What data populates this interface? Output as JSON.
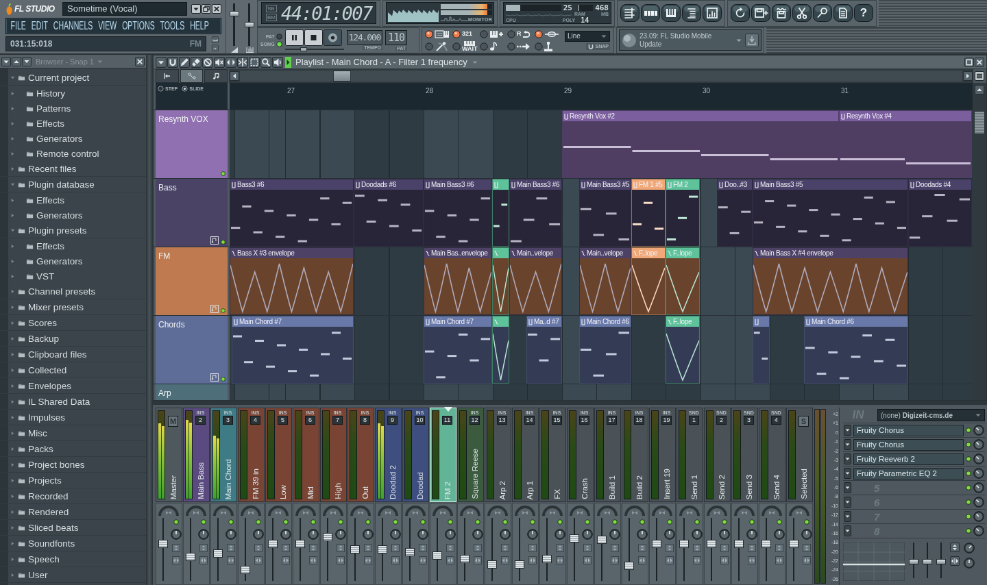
{
  "title_bar": {
    "logo": "FL STUDIO",
    "song_title": "Sometime (Vocal)"
  },
  "menu": [
    "FILE",
    "EDIT",
    "CHANNELS",
    "VIEW",
    "OPTIONS",
    "TOOLS",
    "HELP"
  ],
  "hint_bar": {
    "position": "031:15:018",
    "channel": "FM"
  },
  "master_sliders": [
    {
      "kind": "volume",
      "level": 0.8
    },
    {
      "kind": "pitch",
      "level": 0.5
    }
  ],
  "time_display": {
    "modes": [
      "SB",
      "BM"
    ],
    "time": "44:01:007"
  },
  "monitor": {
    "label": "MONITOR",
    "meters": [
      {
        "level": 0.9
      },
      {
        "level": 0.9
      }
    ]
  },
  "performance": {
    "cpu": {
      "label": "CPU",
      "value": "25",
      "level": 0.26
    },
    "ram": {
      "label": "RAM",
      "value": "468",
      "unit": "MB",
      "level": 0.06
    },
    "poly": {
      "label": "POLY",
      "value": "14"
    }
  },
  "view_buttons": [
    {
      "kind": "playlist"
    },
    {
      "kind": "step_sequencer"
    },
    {
      "kind": "piano_roll"
    },
    {
      "kind": "browser"
    },
    {
      "kind": "mixer"
    }
  ],
  "tool_buttons": [
    {
      "kind": "undo"
    },
    {
      "kind": "save"
    },
    {
      "kind": "export"
    },
    {
      "kind": "cut"
    },
    {
      "kind": "microphone"
    },
    {
      "kind": "document"
    },
    {
      "kind": "help",
      "label": "?"
    }
  ],
  "transport": {
    "modes": [
      {
        "label": "PAT",
        "selected": false
      },
      {
        "label": "SONG",
        "selected": true
      }
    ],
    "buttons": [
      {
        "kind": "pause"
      },
      {
        "kind": "stop"
      },
      {
        "kind": "record"
      }
    ],
    "slider": {
      "level": 0.3
    },
    "tempo": {
      "value": "124.000",
      "label": "TEMPO"
    },
    "pattern": {
      "value": "110",
      "label": "PAT"
    }
  },
  "toggles": [
    {
      "kind": "typing_keyboard",
      "on": true
    },
    {
      "kind": "countdown",
      "label": "321",
      "on": true
    },
    {
      "kind": "step_edit",
      "on": false
    },
    {
      "kind": "loop_record",
      "label": "R",
      "on": false
    },
    {
      "kind": "blend",
      "on": true
    },
    {
      "kind": "metronome",
      "on": false
    },
    {
      "kind": "wait",
      "label": "WAIT",
      "on": false
    },
    {
      "kind": "note_record",
      "on": false
    },
    {
      "kind": "arrow",
      "on": false
    },
    {
      "kind": "joystick",
      "on": false
    }
  ],
  "snap": {
    "value": "Line",
    "label": "SNAP"
  },
  "news": {
    "text": "23.09: FL Studio Mobile Update"
  },
  "browser": {
    "title": "Browser - Snap 1",
    "items": [
      {
        "label": "Current project",
        "expanded": true,
        "children": [
          {
            "label": "History",
            "expanded": false
          },
          {
            "label": "Patterns",
            "expanded": false
          },
          {
            "label": "Effects",
            "expanded": false
          },
          {
            "label": "Generators",
            "expanded": false
          },
          {
            "label": "Remote control",
            "expanded": false
          }
        ]
      },
      {
        "label": "Recent files",
        "expanded": false
      },
      {
        "label": "Plugin database",
        "expanded": true,
        "children": [
          {
            "label": "Effects",
            "expanded": false
          },
          {
            "label": "Generators",
            "expanded": false
          }
        ]
      },
      {
        "label": "Plugin presets",
        "expanded": true,
        "children": [
          {
            "label": "Effects",
            "expanded": false
          },
          {
            "label": "Generators",
            "expanded": false
          },
          {
            "label": "VST",
            "expanded": false
          }
        ]
      },
      {
        "label": "Channel presets",
        "expanded": false
      },
      {
        "label": "Mixer presets",
        "expanded": false
      },
      {
        "label": "Scores",
        "expanded": false
      },
      {
        "label": "Backup",
        "expanded": false
      },
      {
        "label": "Clipboard files",
        "expanded": false
      },
      {
        "label": "Collected",
        "expanded": false
      },
      {
        "label": "Envelopes",
        "expanded": false
      },
      {
        "label": "IL Shared Data",
        "expanded": false
      },
      {
        "label": "Impulses",
        "expanded": false
      },
      {
        "label": "Misc",
        "expanded": false
      },
      {
        "label": "Packs",
        "expanded": false
      },
      {
        "label": "Project bones",
        "expanded": false
      },
      {
        "label": "Projects",
        "expanded": false
      },
      {
        "label": "Recorded",
        "expanded": false
      },
      {
        "label": "Rendered",
        "expanded": false
      },
      {
        "label": "Sliced beats",
        "expanded": false
      },
      {
        "label": "Soundfonts",
        "expanded": false
      },
      {
        "label": "Speech",
        "expanded": false
      },
      {
        "label": "User",
        "expanded": false
      }
    ]
  },
  "playlist": {
    "title": "Playlist - Main Chord - A - Filter 1 frequency",
    "tabs": [
      {
        "kind": "start",
        "selected": false
      },
      {
        "kind": "automation",
        "selected": true
      },
      {
        "kind": "note",
        "selected": false
      }
    ],
    "modes": [
      {
        "label": "STEP",
        "selected": false
      },
      {
        "label": "SLIDE",
        "selected": true
      }
    ],
    "ruler": [
      "27",
      "28",
      "29",
      "30",
      "31"
    ],
    "tracks": [
      {
        "name": "Resynth VOX",
        "color": "#9070b0",
        "clips": [
          {
            "name": "Resynth Vox #2",
            "kind": "pattern",
            "color": "#7b5e9e"
          },
          {
            "name": "Resynth Vox #4",
            "kind": "pattern",
            "color": "#7b5e9e"
          }
        ]
      },
      {
        "name": "Bass",
        "color": "#4a4366",
        "clips": [
          {
            "name": "Bass3 #6",
            "kind": "pattern",
            "color": "#4a4268"
          },
          {
            "name": "Doodads #6",
            "kind": "pattern",
            "color": "#4a4268"
          },
          {
            "name": "Main Bass3 #6",
            "kind": "pattern",
            "color": "#4a4268"
          },
          {
            "kind": "pattern",
            "color": "#5ec39b"
          },
          {
            "name": "Main Bass3 #6",
            "kind": "pattern",
            "color": "#4a4268"
          },
          {
            "name": "Main Bass3 #5",
            "kind": "pattern",
            "color": "#4a4268"
          },
          {
            "name": "FM 1 #5",
            "kind": "pattern",
            "color": "#f0a878"
          },
          {
            "name": "FM 2",
            "kind": "pattern",
            "color": "#5ec39b"
          },
          {
            "name": "Doo..#3",
            "kind": "pattern",
            "color": "#4a4268"
          },
          {
            "name": "Main Bass3 #5",
            "kind": "pattern",
            "color": "#4a4268"
          },
          {
            "name": "Doodads #4",
            "kind": "pattern",
            "color": "#4a4268"
          }
        ]
      },
      {
        "name": "FM",
        "color": "#c07a50",
        "clips": [
          {
            "name": "Bass X #3 envelope",
            "kind": "automation",
            "color": "#4d4266"
          },
          {
            "name": "Main Bas..envelope",
            "kind": "automation",
            "color": "#4d4266"
          },
          {
            "kind": "automation",
            "color": "#5ec39b"
          },
          {
            "name": "Main..velope",
            "kind": "automation",
            "color": "#4d4266"
          },
          {
            "name": "Main..velope",
            "kind": "automation",
            "color": "#4d4266"
          },
          {
            "name": "F..lope",
            "kind": "automation",
            "color": "#f0a878"
          },
          {
            "name": "F..lope",
            "kind": "automation",
            "color": "#5ec39b"
          },
          {
            "name": "Main Bass X #4 envelope",
            "kind": "automation",
            "color": "#4d4266"
          }
        ]
      },
      {
        "name": "Chords",
        "color": "#5e6c98",
        "clips": [
          {
            "name": "Main Chord #7",
            "kind": "pattern",
            "color": "#6878a8"
          },
          {
            "name": "Main Chord #7",
            "kind": "pattern",
            "color": "#6878a8"
          },
          {
            "kind": "automation",
            "color": "#5ec39b"
          },
          {
            "name": "Ma..d #7",
            "kind": "pattern",
            "color": "#6878a8"
          },
          {
            "name": "Main Chord #6",
            "kind": "pattern",
            "color": "#6878a8"
          },
          {
            "name": "F..lope",
            "kind": "automation",
            "color": "#5ec39b"
          },
          {
            "kind": "pattern",
            "color": "#6878a8"
          },
          {
            "name": "Main Chord #6",
            "kind": "pattern",
            "color": "#6878a8"
          }
        ]
      },
      {
        "name": "Arp",
        "color": "#4e6e7a"
      }
    ]
  },
  "mixer": {
    "strips": [
      {
        "kind": "master",
        "label": "Master",
        "badge": "M",
        "color": "#4f585d",
        "selected": false,
        "meter": {
          "level": 0.86
        },
        "fader": {
          "level": 0.6
        }
      },
      {
        "kind": "insert",
        "label": "Main Bass",
        "tag": "INS",
        "badge": "2",
        "color": "#5b4a80",
        "selected": false,
        "meter": {
          "level": 0.9
        },
        "fader": {
          "level": 0.36
        }
      },
      {
        "kind": "insert",
        "label": "Main Chord",
        "tag": "INS",
        "badge": "3",
        "color": "#3e7b85",
        "selected": false,
        "meter": {
          "level": 0.72
        },
        "fader": {
          "level": 0.42
        }
      },
      {
        "kind": "insert",
        "label": "FM 39 in",
        "tag": "INS",
        "badge": "4",
        "color": "#7a4434",
        "selected": false,
        "fader": {
          "level": 0.12
        }
      },
      {
        "kind": "insert",
        "label": "Low",
        "tag": "INS",
        "badge": "5",
        "color": "#7a4434",
        "selected": false,
        "fader": {
          "level": 0.6
        }
      },
      {
        "kind": "insert",
        "label": "Mid",
        "tag": "INS",
        "badge": "6",
        "color": "#7a4434",
        "selected": false,
        "fader": {
          "level": 0.6
        }
      },
      {
        "kind": "insert",
        "label": "High",
        "tag": "INS",
        "badge": "7",
        "color": "#7a4434",
        "selected": false,
        "fader": {
          "level": 0.72
        }
      },
      {
        "kind": "insert",
        "label": "Out",
        "tag": "INS",
        "badge": "8",
        "color": "#7a4434",
        "selected": false,
        "fader": {
          "level": 0.5
        }
      },
      {
        "kind": "insert",
        "label": "Doodad 2",
        "tag": "INS",
        "badge": "9",
        "color": "#3e4e7e",
        "selected": false,
        "meter": {
          "level": 0.86
        },
        "fader": {
          "level": 0.5
        }
      },
      {
        "kind": "insert",
        "label": "Doodad",
        "tag": "INS",
        "badge": "10",
        "color": "#3e4e7e",
        "selected": false,
        "fader": {
          "level": 0.45
        }
      },
      {
        "kind": "insert",
        "label": "FM 2",
        "badge": "11",
        "color": "#62b497",
        "selected": true,
        "fader": {
          "level": 0.39
        }
      },
      {
        "kind": "insert",
        "label": "Square Reese",
        "tag": "INS",
        "badge": "12",
        "color": "#3c5a3e",
        "selected": false,
        "fader": {
          "level": 0.33
        }
      },
      {
        "kind": "insert",
        "label": "Arp 2",
        "tag": "INS",
        "badge": "13",
        "color": "#4a5257",
        "selected": false,
        "fader": {
          "level": 0.22
        }
      },
      {
        "kind": "insert",
        "label": "Arp 1",
        "tag": "INS",
        "badge": "14",
        "color": "#4a5257",
        "selected": false,
        "fader": {
          "level": 0.22
        }
      },
      {
        "kind": "insert",
        "label": "FX",
        "tag": "INS",
        "badge": "15",
        "color": "#4a5257",
        "selected": false,
        "fader": {
          "level": 0.32
        }
      },
      {
        "kind": "insert",
        "label": "Crash",
        "tag": "INS",
        "badge": "16",
        "color": "#4a5257",
        "selected": false,
        "fader": {
          "level": 0.7
        }
      },
      {
        "kind": "insert",
        "label": "Build 1",
        "tag": "INS",
        "badge": "17",
        "color": "#4a5257",
        "selected": false,
        "fader": {
          "level": 0.68
        }
      },
      {
        "kind": "insert",
        "label": "Build 2",
        "tag": "INS",
        "badge": "18",
        "color": "#4a5257",
        "selected": false,
        "fader": {
          "level": 0.2
        }
      },
      {
        "kind": "insert",
        "label": "Insert 19",
        "tag": "INS",
        "badge": "19",
        "color": "#4a5257",
        "selected": false,
        "fader": {
          "level": 0.6
        }
      },
      {
        "kind": "send",
        "label": "Send 1",
        "tag": "SND",
        "badge": "1",
        "color": "#4a5257",
        "selected": false,
        "fader": {
          "level": 0.6
        }
      },
      {
        "kind": "send",
        "label": "Send 2",
        "tag": "SND",
        "badge": "2",
        "color": "#4a5257",
        "selected": false,
        "fader": {
          "level": 0.6
        }
      },
      {
        "kind": "send",
        "label": "Send 3",
        "tag": "SND",
        "badge": "3",
        "color": "#4a5257",
        "selected": false,
        "fader": {
          "level": 0.6
        }
      },
      {
        "kind": "send",
        "label": "Send 4",
        "tag": "SND",
        "badge": "4",
        "color": "#4a5257",
        "selected": false,
        "fader": {
          "level": 0.6
        }
      },
      {
        "kind": "selected",
        "label": "Selected",
        "badge": "S",
        "color": "#4a5257",
        "selected": false,
        "fader": {
          "level": 0.6
        }
      }
    ],
    "db_scale": [
      "+2",
      "+1",
      "0",
      "-1",
      "-2",
      "-3",
      "-4",
      "-5",
      "-6",
      "-8",
      "-10",
      "-12",
      "-14",
      "-16",
      "-18",
      "-20",
      "-22",
      "-24",
      "-26"
    ],
    "fx": {
      "logo": "IN",
      "input": "(none) **Digizeit-cms.de**",
      "slots": [
        {
          "kind": "plugin",
          "name": "Fruity Chorus",
          "on": true
        },
        {
          "kind": "plugin",
          "name": "Fruity Chorus",
          "on": true
        },
        {
          "kind": "plugin",
          "name": "Fruity Reeverb 2",
          "on": true
        },
        {
          "kind": "plugin",
          "name": "Fruity Parametric EQ 2",
          "on": true
        },
        {
          "kind": "empty",
          "number": "5",
          "on": true
        },
        {
          "kind": "empty",
          "number": "6",
          "on": true
        },
        {
          "kind": "empty",
          "number": "7",
          "on": true
        },
        {
          "kind": "empty",
          "number": "8",
          "on": true
        }
      ],
      "eq_bands": [
        {
          "level": 0.45
        },
        {
          "level": 0.45
        },
        {
          "level": 0.45
        }
      ]
    }
  }
}
